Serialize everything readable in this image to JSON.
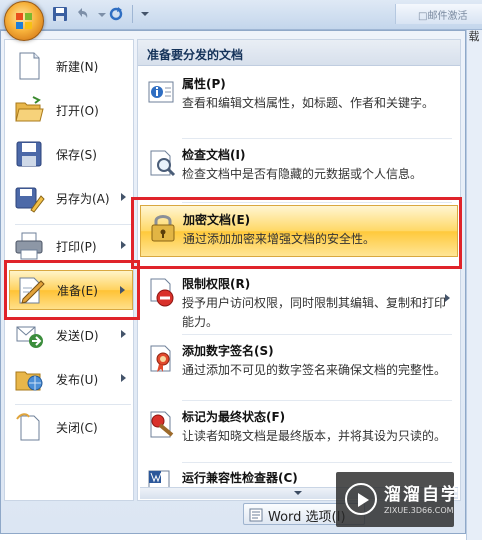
{
  "qat": {
    "right_text": "□邮件激活"
  },
  "side_strip": {
    "text": "载"
  },
  "left_menu": {
    "items": [
      {
        "label": "新建(N)",
        "icon": "new-document-icon",
        "arrow": false
      },
      {
        "label": "打开(O)",
        "icon": "open-folder-icon",
        "arrow": false
      },
      {
        "label": "保存(S)",
        "icon": "save-disk-icon",
        "arrow": false
      },
      {
        "label": "另存为(A)",
        "icon": "save-as-icon",
        "arrow": true
      },
      {
        "label": "打印(P)",
        "icon": "printer-icon",
        "arrow": true
      },
      {
        "label": "准备(E)",
        "icon": "prepare-pen-icon",
        "arrow": true,
        "active": true
      },
      {
        "label": "发送(D)",
        "icon": "send-icon",
        "arrow": true
      },
      {
        "label": "发布(U)",
        "icon": "publish-folder-icon",
        "arrow": true
      },
      {
        "label": "关闭(C)",
        "icon": "close-document-icon",
        "arrow": false
      }
    ]
  },
  "right_panel": {
    "header": "准备要分发的文档",
    "items": [
      {
        "title": "属性(P)",
        "desc": "查看和编辑文档属性，如标题、作者和关键字。",
        "icon": "properties-icon"
      },
      {
        "title": "检查文档(I)",
        "desc": "检查文档中是否有隐藏的元数据或个人信息。",
        "icon": "inspect-document-icon"
      },
      {
        "title": "加密文档(E)",
        "desc": "通过添加加密来增强文档的安全性。",
        "icon": "encrypt-lock-icon",
        "highlighted": true
      },
      {
        "title": "限制权限(R)",
        "desc": "授予用户访问权限，同时限制其编辑、复制和打印能力。",
        "icon": "restrict-permission-icon",
        "arrow": true
      },
      {
        "title": "添加数字签名(S)",
        "desc": "通过添加不可见的数字签名来确保文档的完整性。",
        "icon": "digital-signature-icon"
      },
      {
        "title": "标记为最终状态(F)",
        "desc": "让读者知晓文档是最终版本，并将其设为只读的。",
        "icon": "mark-final-icon"
      },
      {
        "title": "运行兼容性检查器(C)",
        "desc": "",
        "icon": "compatibility-checker-icon"
      }
    ]
  },
  "bottom": {
    "word_options": "Word 选项(I)"
  },
  "watermark": {
    "cn": "溜溜自学",
    "en": "ZIXUE.3D66.COM"
  },
  "colors": {
    "highlight": "#ffc93b",
    "annotation": "#e0232a",
    "menu_bg": "#dce6f3"
  }
}
